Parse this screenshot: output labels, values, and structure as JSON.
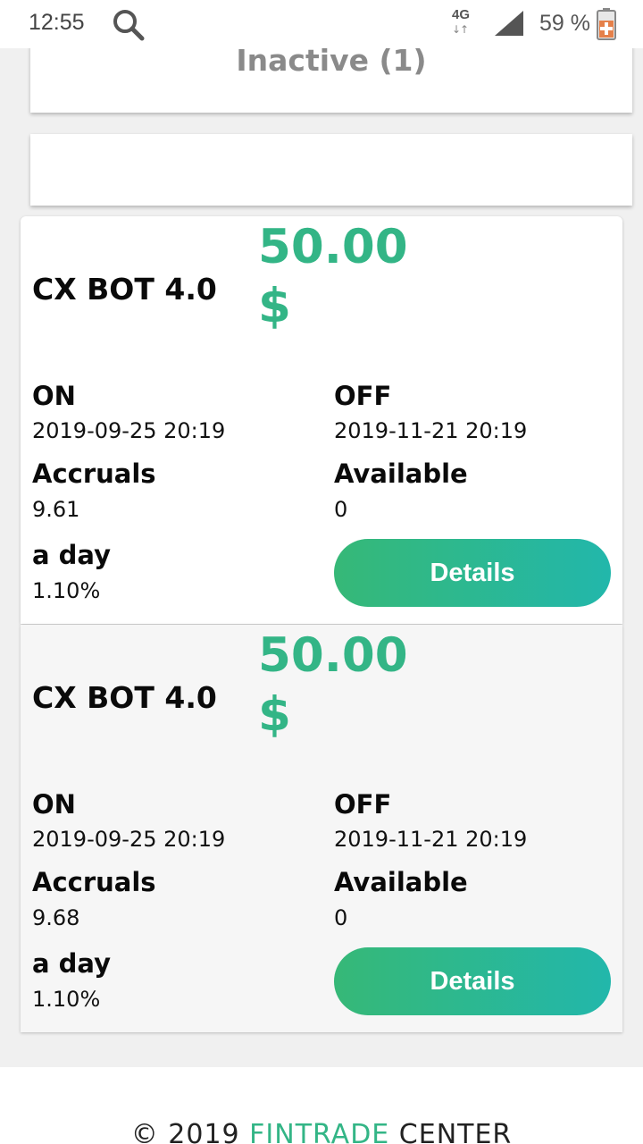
{
  "status_bar": {
    "time": "12:55",
    "network": "4G",
    "network_arrows": "↓↑",
    "battery_percent": "59 %",
    "icons": [
      "search-icon",
      "signal-icon",
      "battery-icon"
    ]
  },
  "inactive_section": {
    "title": "Inactive (1)"
  },
  "bots": [
    {
      "name": "CX BOT 4.0",
      "price": "50.00",
      "currency": "$",
      "on_label": "ON",
      "on_value": "2019-09-25 20:19",
      "off_label": "OFF",
      "off_value": "2019-11-21 20:19",
      "accruals_label": "Accruals",
      "accruals_value": "9.61",
      "available_label": "Available",
      "available_value": "0",
      "day_label": "a day",
      "day_value": "1.10%",
      "button_label": "Details"
    },
    {
      "name": "CX BOT 4.0",
      "price": "50.00",
      "currency": "$",
      "on_label": "ON",
      "on_value": "2019-09-25 20:19",
      "off_label": "OFF",
      "off_value": "2019-11-21 20:19",
      "accruals_label": "Accruals",
      "accruals_value": "9.68",
      "available_label": "Available",
      "available_value": "0",
      "day_label": "a day",
      "day_value": "1.10%",
      "button_label": "Details"
    }
  ],
  "footer": {
    "copyright": "© 2019",
    "brand_accent": "FINTRADE",
    "brand_rest": "CENTER"
  },
  "colors": {
    "accent_green": "#33b586",
    "button_gradient_start": "#36b877",
    "button_gradient_end": "#22b7ab"
  }
}
